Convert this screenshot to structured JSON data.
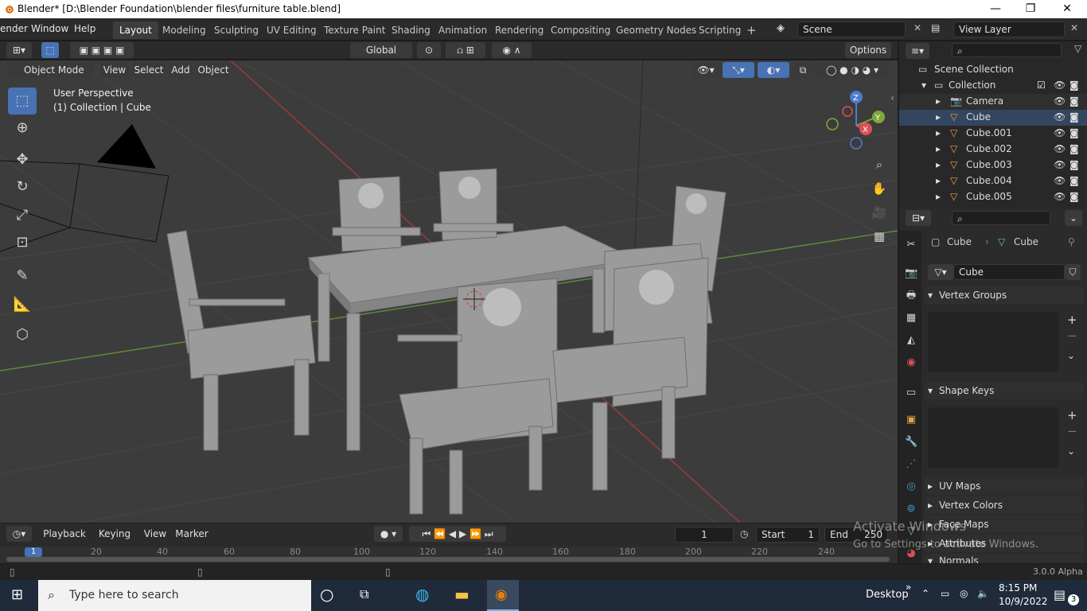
{
  "window": {
    "title": "Blender* [D:\\Blender Foundation\\blender files\\furniture table.blend]",
    "min": "—",
    "max": "❐",
    "close": "✕"
  },
  "menu": {
    "items": [
      "ender",
      "Window",
      "Help"
    ]
  },
  "workspaces": [
    "Layout",
    "Modeling",
    "Sculpting",
    "UV Editing",
    "Texture Paint",
    "Shading",
    "Animation",
    "Rendering",
    "Compositing",
    "Geometry Nodes",
    "Scripting"
  ],
  "scene": {
    "label": "Scene",
    "view_layer": "View Layer"
  },
  "toolbar": {
    "orientation": "Global",
    "options": "Options"
  },
  "viewport_header": {
    "mode": "Object Mode",
    "menus": [
      "View",
      "Select",
      "Add",
      "Object"
    ]
  },
  "viewport": {
    "perspective": "User Perspective",
    "context": "(1) Collection | Cube"
  },
  "gizmo": {
    "x": "X",
    "y": "Y",
    "z": "Z"
  },
  "outliner": {
    "root": "Scene Collection",
    "collection": "Collection",
    "items": [
      "Camera",
      "Cube",
      "Cube.001",
      "Cube.002",
      "Cube.003",
      "Cube.004",
      "Cube.005"
    ]
  },
  "properties": {
    "breadcrumb_object": "Cube",
    "breadcrumb_data": "Cube",
    "mesh_name": "Cube",
    "panels": [
      "Vertex Groups",
      "Shape Keys",
      "UV Maps",
      "Vertex Colors",
      "Face Maps",
      "Attributes",
      "Normals"
    ]
  },
  "timeline": {
    "menus": [
      "Playback",
      "Keying",
      "View",
      "Marker"
    ],
    "current_frame": "1",
    "start_label": "Start",
    "start": "1",
    "end_label": "End",
    "end": "250",
    "ticks": [
      "20",
      "40",
      "60",
      "80",
      "100",
      "120",
      "140",
      "160",
      "180",
      "200",
      "220",
      "240"
    ],
    "playhead": "1"
  },
  "status": {
    "version": "3.0.0 Alpha"
  },
  "watermark": {
    "line1": "Activate Windows",
    "line2": "Go to Settings to activate Windows."
  },
  "taskbar": {
    "search_placeholder": "Type here to search",
    "desktop": "Desktop",
    "time": "8:15 PM",
    "date": "10/9/2022",
    "notifications": "3"
  }
}
